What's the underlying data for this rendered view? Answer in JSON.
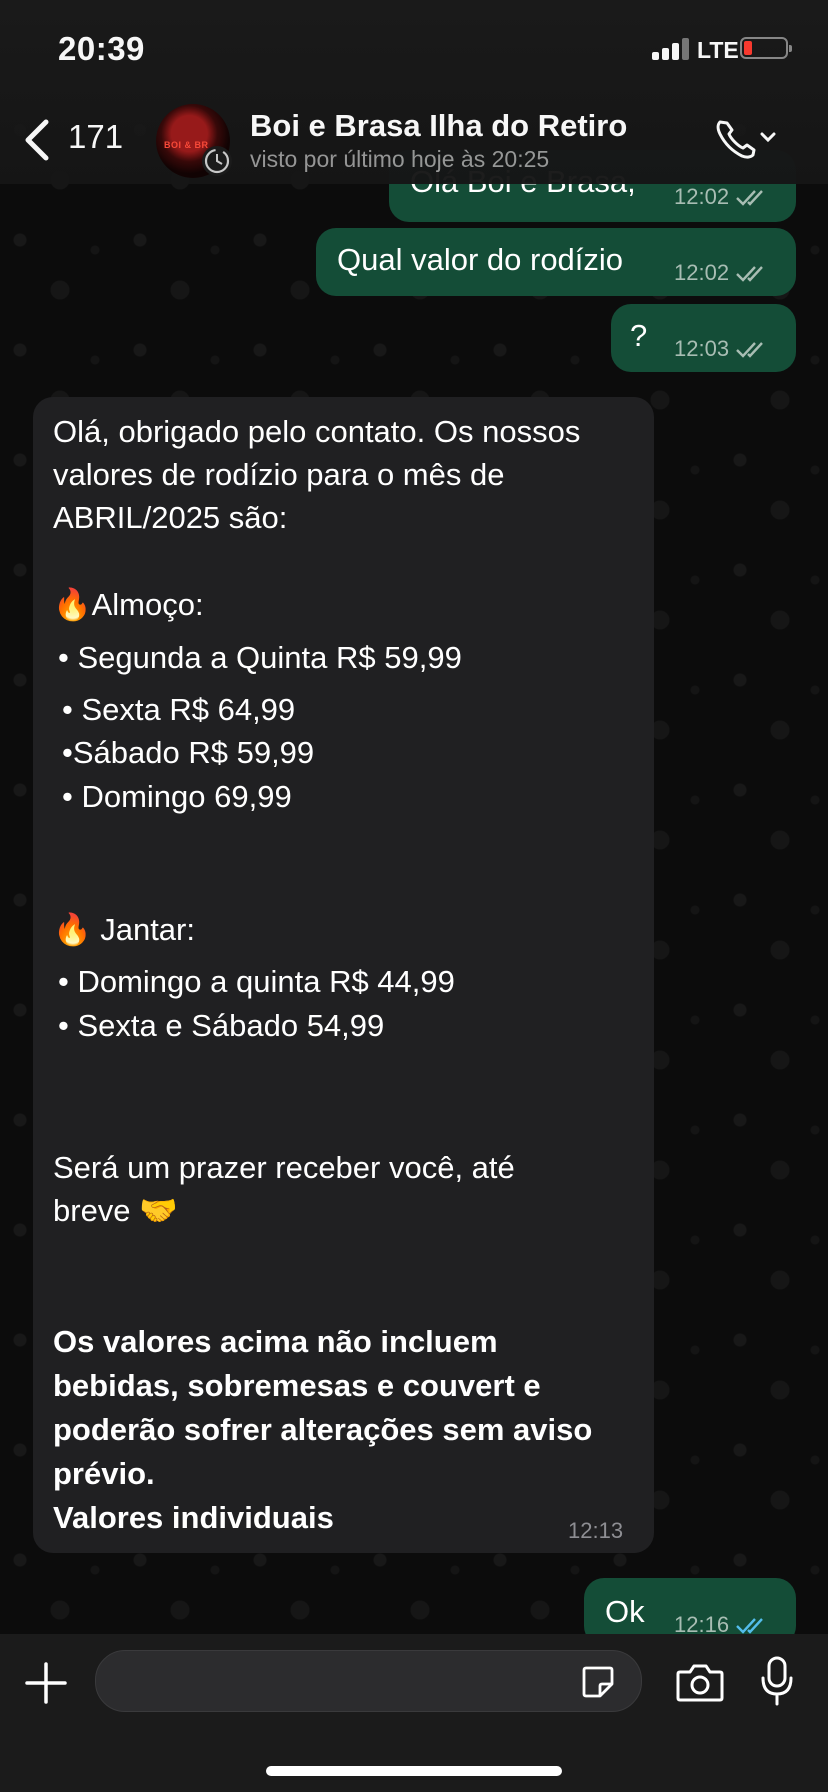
{
  "status_bar": {
    "time": "20:39",
    "network": "LTE",
    "battery_color": "#ff3b30"
  },
  "header": {
    "back_count": "171",
    "avatar_text": "BOI & BR",
    "contact_name": "Boi e Brasa Ilha do Retiro",
    "last_seen": "visto por último hoje às 20:25"
  },
  "messages": {
    "out1": {
      "text": "Olá Boi e Brasa,",
      "time": "12:02"
    },
    "out2": {
      "text": "Qual valor do rodízio",
      "time": "12:02"
    },
    "out3": {
      "text": "?",
      "time": "12:03"
    },
    "in1": {
      "lines": [
        "Olá, obrigado pelo contato. Os nossos",
        "valores de rodízio para o mês de",
        "ABRIL/2025 são:",
        "🔥Almoço:",
        "•  Segunda a Quinta R$ 59,99",
        "• Sexta R$ 64,99",
        "•Sábado R$ 59,99",
        "• Domingo 69,99",
        "🔥 Jantar:",
        "•  Domingo a quinta R$ 44,99",
        "•  Sexta e Sábado 54,99",
        "Será um prazer receber você, até",
        "breve 🤝",
        "Os valores acima não incluem",
        "bebidas, sobremesas e couvert e",
        "poderão sofrer alterações sem aviso",
        "prévio.",
        "Valores individuais"
      ],
      "time": "12:13"
    },
    "out4": {
      "text": "Ok",
      "time": "12:16"
    }
  },
  "colors": {
    "outgoing_bubble": "#144d37",
    "incoming_bubble": "#202022",
    "read_ticks": "#53bdeb",
    "sent_ticks": "#a8bdb3"
  },
  "icons": [
    "back-chevron-icon",
    "phone-icon",
    "plus-icon",
    "sticker-icon",
    "camera-icon",
    "microphone-icon"
  ]
}
